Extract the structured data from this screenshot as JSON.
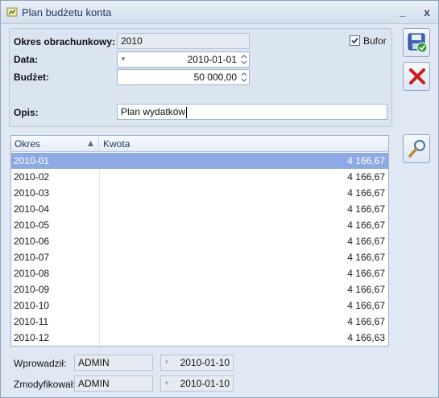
{
  "window": {
    "title": "Plan budżetu konta",
    "minimize_glyph": "_",
    "close_glyph": "x"
  },
  "form": {
    "okres_label": "Okres obrachunkowy:",
    "okres_value": "2010",
    "data_label": "Data:",
    "data_value": "2010-01-01",
    "budzet_label": "Budżet:",
    "budzet_value": "50 000,00",
    "bufor_label": "Bufor",
    "bufor_checked": true,
    "opis_label": "Opis:",
    "opis_value": "Plan wydatków"
  },
  "table": {
    "columns": [
      "Okres",
      "Kwota"
    ],
    "rows": [
      {
        "okres": "2010-01",
        "kwota": "4 166,67",
        "selected": true
      },
      {
        "okres": "2010-02",
        "kwota": "4 166,67"
      },
      {
        "okres": "2010-03",
        "kwota": "4 166,67"
      },
      {
        "okres": "2010-04",
        "kwota": "4 166,67"
      },
      {
        "okres": "2010-05",
        "kwota": "4 166,67"
      },
      {
        "okres": "2010-06",
        "kwota": "4 166,67"
      },
      {
        "okres": "2010-07",
        "kwota": "4 166,67"
      },
      {
        "okres": "2010-08",
        "kwota": "4 166,67"
      },
      {
        "okres": "2010-09",
        "kwota": "4 166,67"
      },
      {
        "okres": "2010-10",
        "kwota": "4 166,67"
      },
      {
        "okres": "2010-11",
        "kwota": "4 166,67"
      },
      {
        "okres": "2010-12",
        "kwota": "4 166,63"
      }
    ]
  },
  "footer": {
    "wprowadzil_label": "Wprowadził:",
    "wprowadzil_user": "ADMIN",
    "wprowadzil_date": "2010-01-10",
    "zmodyfikowal_label": "Zmodyfikował:",
    "zmodyfikowal_user": "ADMIN",
    "zmodyfikowal_date": "2010-01-10"
  },
  "icons": {
    "save": "save-icon",
    "cancel": "cancel-icon",
    "preview": "magnifier-icon"
  },
  "colors": {
    "selection": "#8ea9e3",
    "window_bg": "#dfe8f3",
    "cancel_red": "#d01a1a"
  }
}
